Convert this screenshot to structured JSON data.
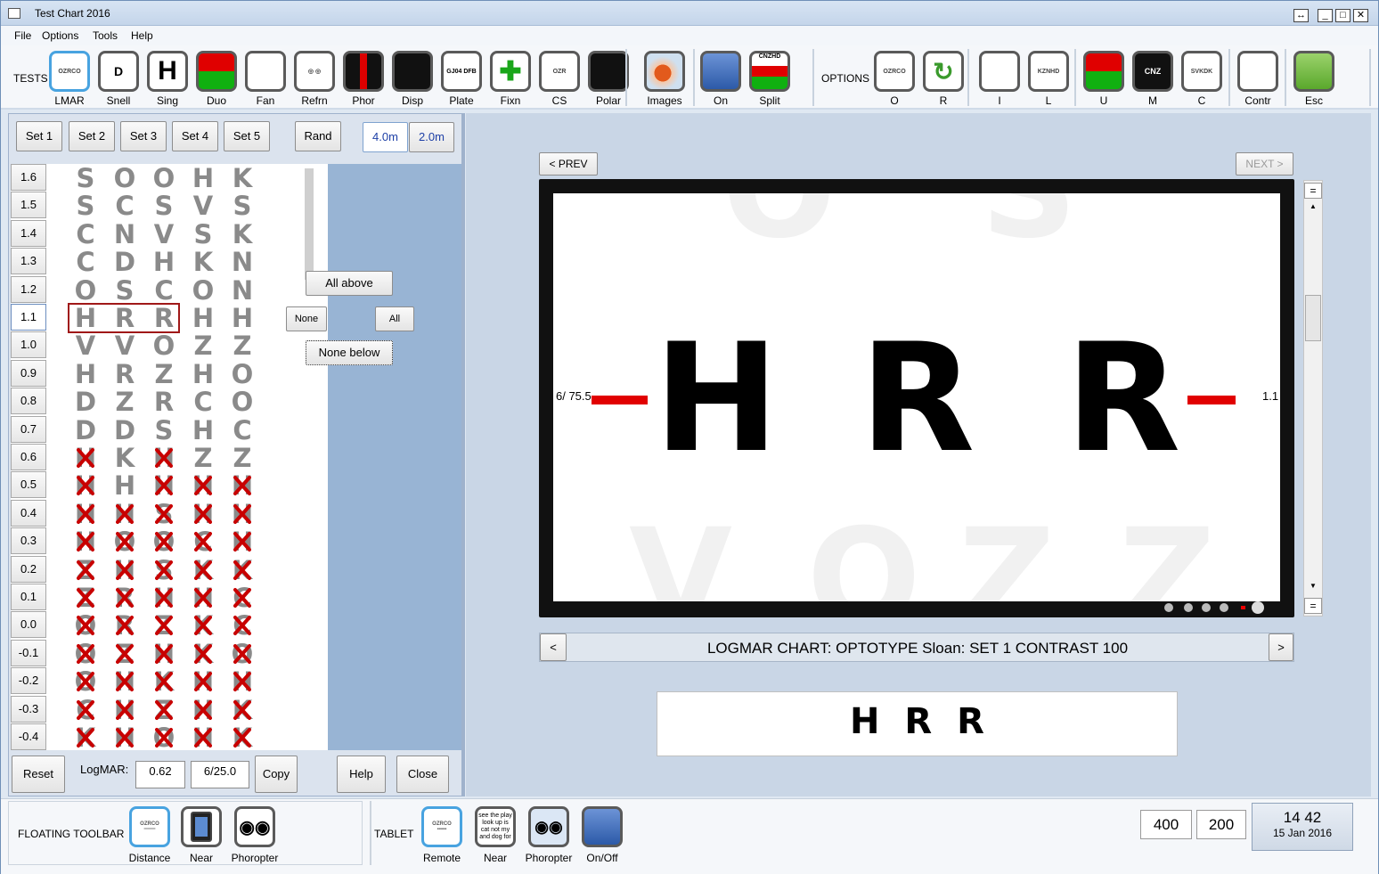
{
  "window": {
    "title": "Test Chart 2016",
    "restore_glyph": "↔",
    "min_glyph": "_",
    "max_glyph": "□",
    "close_glyph": "✕"
  },
  "menu": [
    "File",
    "Options",
    "Tools",
    "Help"
  ],
  "toolbar": {
    "tests_label": "TESTS",
    "options_label": "OPTIONS",
    "tests": [
      {
        "label": "LMAR",
        "icon": "logmar-chart-icon",
        "art": "OZRCO"
      },
      {
        "label": "Snell",
        "icon": "snellen-chart-icon",
        "art": "D"
      },
      {
        "label": "Sing",
        "icon": "single-letter-icon",
        "art": "H"
      },
      {
        "label": "Duo",
        "icon": "duochrome-icon",
        "art": ""
      },
      {
        "label": "Fan",
        "icon": "fan-chart-icon",
        "art": ""
      },
      {
        "label": "Refrn",
        "icon": "refraction-icon",
        "art": "◎ ◎"
      },
      {
        "label": "Phor",
        "icon": "phoria-icon",
        "art": ""
      },
      {
        "label": "Disp",
        "icon": "disparity-icon",
        "art": ""
      },
      {
        "label": "Plate",
        "icon": "plate-icon",
        "art": "GJ04 DFB"
      },
      {
        "label": "Fixn",
        "icon": "fixation-cross-icon",
        "art": "✚"
      },
      {
        "label": "CS",
        "icon": "contrast-sensitivity-icon",
        "art": "OZR"
      },
      {
        "label": "Polar",
        "icon": "polar-icon",
        "art": ""
      },
      {
        "label": "Images",
        "icon": "images-eye-icon",
        "art": ""
      },
      {
        "label": "On",
        "icon": "on-screen-icon",
        "art": ""
      },
      {
        "label": "Split",
        "icon": "split-icon",
        "art": "CNZHD"
      }
    ],
    "options": [
      {
        "label": "O",
        "icon": "optotype-option-icon",
        "art": "OZRCO"
      },
      {
        "label": "R",
        "icon": "randomize-option-icon",
        "art": "↻"
      },
      {
        "label": "I",
        "icon": "isolate-option-icon",
        "art": ""
      },
      {
        "label": "L",
        "icon": "line-option-icon",
        "art": "KZNHD"
      },
      {
        "label": "U",
        "icon": "duochrome-option-icon",
        "art": ""
      },
      {
        "label": "M",
        "icon": "mirror-option-icon",
        "art": "CNZ"
      },
      {
        "label": "C",
        "icon": "crowding-option-icon",
        "art": "SVKDK"
      },
      {
        "label": "Contr",
        "icon": "contrast-option-icon",
        "art": ""
      },
      {
        "label": "Esc",
        "icon": "escape-arrow-icon",
        "art": ""
      }
    ]
  },
  "left": {
    "set_buttons": [
      "Set 1",
      "Set 2",
      "Set 3",
      "Set 4",
      "Set 5"
    ],
    "rand_label": "Rand",
    "distance_buttons": [
      "4.0m",
      "2.0m"
    ],
    "rows": [
      {
        "label": "1.6",
        "letters": "SOOHK",
        "x": "00000"
      },
      {
        "label": "1.5",
        "letters": "SCSVS",
        "x": "00000"
      },
      {
        "label": "1.4",
        "letters": "CNVSK",
        "x": "00000"
      },
      {
        "label": "1.3",
        "letters": "CDHKN",
        "x": "00000"
      },
      {
        "label": "1.2",
        "letters": "OSCON",
        "x": "00000"
      },
      {
        "label": "1.1",
        "letters": "HRRHH",
        "x": "00000"
      },
      {
        "label": "1.0",
        "letters": "VVOZZ",
        "x": "00000"
      },
      {
        "label": "0.9",
        "letters": "HRZHO",
        "x": "00000"
      },
      {
        "label": "0.8",
        "letters": "DZRCO",
        "x": "00000"
      },
      {
        "label": "0.7",
        "letters": "DDSHC",
        "x": "00000"
      },
      {
        "label": "0.6",
        "letters": "HKHZZ",
        "x": "10100"
      },
      {
        "label": "0.5",
        "letters": "HHHHH",
        "x": "10111"
      },
      {
        "label": "0.4",
        "letters": "HHSHH",
        "x": "11111"
      },
      {
        "label": "0.3",
        "letters": "HOOCH",
        "x": "11111"
      },
      {
        "label": "0.2",
        "letters": "ZHSKK",
        "x": "11111"
      },
      {
        "label": "0.1",
        "letters": "ZRHHC",
        "x": "11111"
      },
      {
        "label": "0.0",
        "letters": "ORZKC",
        "x": "11111"
      },
      {
        "label": "-0.1",
        "letters": "OZHKO",
        "x": "11111"
      },
      {
        "label": "-0.2",
        "letters": "OHKHH",
        "x": "11111"
      },
      {
        "label": "-0.3",
        "letters": "CHZHK",
        "x": "11111"
      },
      {
        "label": "-0.4",
        "letters": "KHOHK",
        "x": "11111"
      }
    ],
    "selected_row": "1.1",
    "popup": {
      "all_above": "All above",
      "none": "None",
      "all": "All",
      "none_below": "None below"
    },
    "reset_label": "Reset",
    "logmar_label": "LogMAR:",
    "logmar_value": "0.62",
    "snellen_value": "6/25.0",
    "copy_label": "Copy",
    "help_label": "Help",
    "close_label": "Close"
  },
  "display": {
    "prev_label": "< PREV",
    "next_label": "NEXT >",
    "line_letters": [
      "H",
      "R",
      "R"
    ],
    "snellen_left": "6/ 75.5",
    "logmar_right": "1.1",
    "ghost_top": [
      "O",
      "S"
    ],
    "ghost_bottom": [
      "V",
      "O",
      "Z",
      "Z"
    ],
    "info_text": "LOGMAR CHART:  OPTOTYPE Sloan:   SET 1  CONTRAST  100",
    "left_arrow": "<",
    "right_arrow": ">",
    "preview_text": "H R R",
    "scroll_eq": "="
  },
  "bottom": {
    "floating_label": "FLOATING TOOLBAR",
    "tablet_label": "TABLET",
    "floating": [
      {
        "label": "Distance",
        "icon": "distance-chart-icon"
      },
      {
        "label": "Near",
        "icon": "tablet-device-icon"
      },
      {
        "label": "Phoropter",
        "icon": "phoropter-icon"
      }
    ],
    "tablet": [
      {
        "label": "Remote",
        "icon": "remote-icon"
      },
      {
        "label": "Near",
        "icon": "near-text-icon"
      },
      {
        "label": "Phoropter",
        "icon": "phoropter-icon"
      },
      {
        "label": "On/Off",
        "icon": "on-off-icon"
      }
    ],
    "near_text": "see the play look up is cat not my and dog for",
    "num1": "400",
    "num2": "200",
    "time": "14 42",
    "date": "15 Jan 2016"
  },
  "colors": {
    "accent": "#48a3e0",
    "panel_blue": "#98b4d4",
    "mark_red": "#c80000"
  }
}
